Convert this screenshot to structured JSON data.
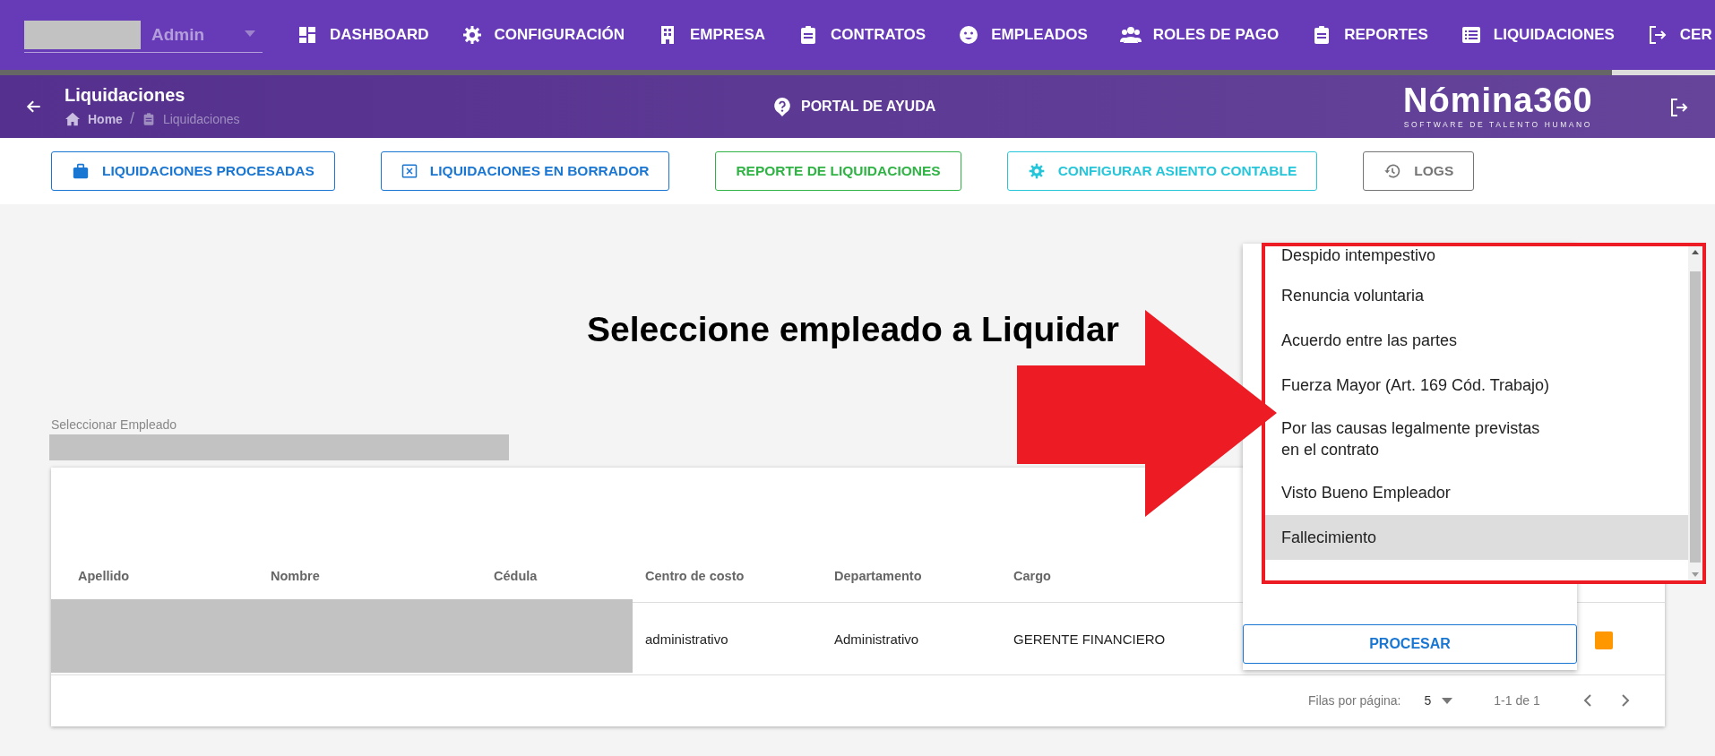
{
  "top_nav": {
    "user_select": {
      "value": "Admin"
    },
    "items": [
      {
        "label": "DASHBOARD"
      },
      {
        "label": "CONFIGURACIÓN"
      },
      {
        "label": "EMPRESA"
      },
      {
        "label": "CONTRATOS"
      },
      {
        "label": "EMPLEADOS"
      },
      {
        "label": "ROLES DE PAGO"
      },
      {
        "label": "REPORTES"
      },
      {
        "label": "LIQUIDACIONES"
      },
      {
        "label": "CER"
      }
    ],
    "progress": {
      "level": 0.94
    }
  },
  "header": {
    "title": "Liquidaciones",
    "breadcrumb": [
      "Home",
      "Liquidaciones"
    ],
    "breadcrumb_separator": "/",
    "help_link": "PORTAL DE AYUDA",
    "logo": {
      "name": "Nómina360",
      "tagline": "SOFTWARE DE TALENTO HUMANO"
    }
  },
  "actions": [
    {
      "label": "LIQUIDACIONES PROCESADAS",
      "color": "#1976d2"
    },
    {
      "label": "LIQUIDACIONES EN BORRADOR",
      "color": "#1976d2"
    },
    {
      "label": "REPORTE DE LIQUIDACIONES",
      "color": "#2fb344"
    },
    {
      "label": "CONFIGURAR ASIENTO CONTABLE",
      "color": "#26c6da"
    },
    {
      "label": "LOGS",
      "color": "#757575"
    }
  ],
  "main": {
    "heading": "Seleccione empleado a Liquidar",
    "employee_field": {
      "label": "Seleccionar Empleado"
    }
  },
  "table": {
    "columns": [
      "Apellido",
      "Nombre",
      "Cédula",
      "Centro de costo",
      "Departamento",
      "Cargo"
    ],
    "rows": [
      [
        "",
        "",
        "",
        "administrativo",
        "Administrativo",
        "GERENTE FINANCIERO"
      ]
    ],
    "pagination": {
      "rows_per_page_label": "Filas por página:",
      "rows_per_page": "5",
      "range": "1-1 de 1"
    }
  },
  "reason_menu": {
    "items": [
      {
        "label": "Despido intempestivo",
        "selected": false
      },
      {
        "label": "Renuncia voluntaria",
        "selected": false
      },
      {
        "label": "Acuerdo entre las partes",
        "selected": false
      },
      {
        "label": "Fuerza Mayor (Art. 169 Cód. Trabajo)",
        "selected": false
      },
      {
        "label": "Por las causas legalmente previstas en el contrato",
        "selected": false
      },
      {
        "label": "Visto Bueno Empleador",
        "selected": false
      },
      {
        "label": "Fallecimiento",
        "selected": true
      }
    ],
    "button": "PROCESAR"
  }
}
